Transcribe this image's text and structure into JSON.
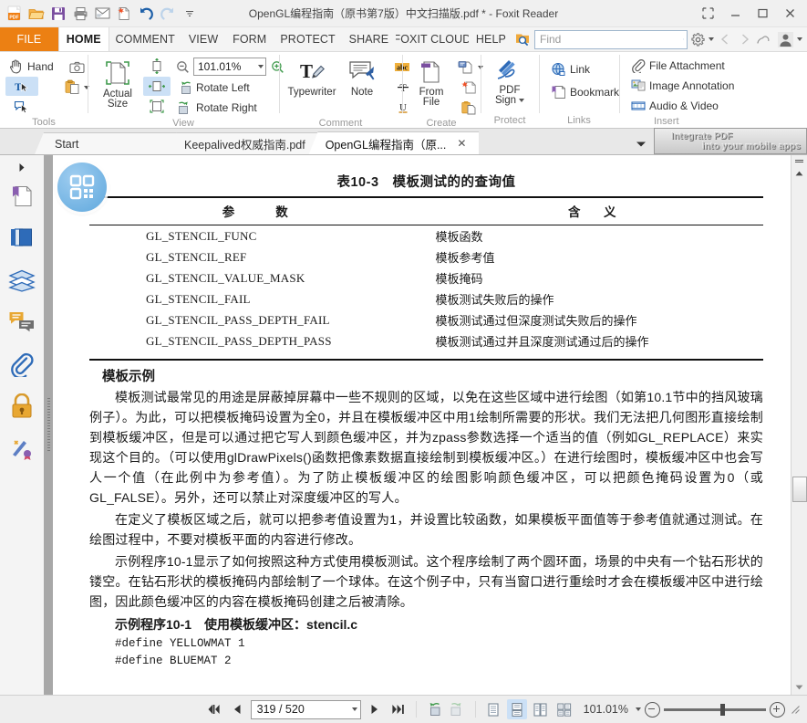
{
  "window": {
    "title": "OpenGL编程指南（原书第7版）中文扫描版.pdf * - Foxit Reader",
    "quick_access": [
      "pdf-logo-icon",
      "open-icon",
      "save-icon",
      "print-icon",
      "email-icon",
      "new-from-file-icon",
      "undo-icon",
      "redo-icon",
      "customize-qat-icon"
    ],
    "controls": [
      "restore-small-icon",
      "minimize-icon",
      "maximize-icon",
      "close-icon"
    ]
  },
  "ribbon": {
    "tabs": [
      {
        "label": "FILE",
        "id": "file"
      },
      {
        "label": "HOME",
        "id": "home"
      },
      {
        "label": "COMMENT",
        "id": "comment"
      },
      {
        "label": "VIEW",
        "id": "view"
      },
      {
        "label": "FORM",
        "id": "form"
      },
      {
        "label": "PROTECT",
        "id": "protect"
      },
      {
        "label": "SHARE",
        "id": "share"
      },
      {
        "label": "FOXIT CLOUD",
        "id": "foxit-cloud"
      },
      {
        "label": "HELP",
        "id": "help"
      }
    ],
    "active_tab": "HOME",
    "search": {
      "placeholder": "Find",
      "value": ""
    },
    "groups": [
      {
        "title": "Tools"
      },
      {
        "title": "View"
      },
      {
        "title": "Comment"
      },
      {
        "title": "Create"
      },
      {
        "title": "Protect"
      },
      {
        "title": "Links"
      },
      {
        "title": "Insert"
      }
    ],
    "tools": {
      "hand": "Hand",
      "snapshot_icon": "camera-icon",
      "select_text_icon": "select-text-icon",
      "select_annotation_icon": "select-annotation-icon",
      "clipboard_icon": "clipboard-paste-icon"
    },
    "view": {
      "actual_size": "Actual\nSize",
      "actual_size_l1": "Actual",
      "actual_size_l2": "Size",
      "fit_page_icon": "fit-page-icon",
      "fit_width_icon": "fit-width-icon",
      "fit_visible_icon": "fit-visible-icon",
      "zoom_out_icon": "zoom-out-icon",
      "zoom_in_icon": "zoom-in-icon",
      "zoom_value": "101.01%",
      "rotate_left": "Rotate Left",
      "rotate_right": "Rotate Right"
    },
    "comment": {
      "typewriter": "Typewriter",
      "note": "Note",
      "highlight_icon": "abc-highlight-icon",
      "strikeout_icon": "strikeout-icon",
      "underline_icon": "underline-icon"
    },
    "create": {
      "from_file_l1": "From",
      "from_file_l2": "File",
      "from_scanner_icon": "from-scanner-icon",
      "from_blank_icon": "blank-page-icon",
      "from_clipboard_icon": "from-clipboard-icon"
    },
    "protect": {
      "pdf_sign_l1": "PDF",
      "pdf_sign_l2": "Sign"
    },
    "links": {
      "link": "Link",
      "bookmark": "Bookmark"
    },
    "insert": {
      "file_attachment": "File Attachment",
      "image_annotation": "Image Annotation",
      "audio_video": "Audio & Video"
    }
  },
  "doc_tabs": {
    "items": [
      {
        "label": "Start",
        "active": false,
        "closable": false
      },
      {
        "label": "Keepalived权威指南.pdf",
        "active": false,
        "closable": false
      },
      {
        "label": "OpenGL编程指南（原...",
        "active": true,
        "closable": true,
        "close_label": "✕"
      }
    ],
    "overflow_icon": "chevron-down-icon",
    "promo_line1": "Integrate PDF",
    "promo_line2": "into your mobile apps"
  },
  "nav_pane": {
    "expander_icon": "expand-pane-icon",
    "items": [
      {
        "icon": "bookmarks-icon",
        "name": "bookmarks"
      },
      {
        "icon": "page-thumbnails-icon",
        "name": "page-thumbnails"
      },
      {
        "icon": "layers-icon",
        "name": "layers"
      },
      {
        "icon": "comments-icon",
        "name": "comments"
      },
      {
        "icon": "attachments-icon",
        "name": "attachments"
      },
      {
        "icon": "security-lock-icon",
        "name": "security"
      },
      {
        "icon": "digital-signature-icon",
        "name": "digital-signatures"
      }
    ]
  },
  "document": {
    "qr_badge_icon": "qr-code-icon",
    "table": {
      "caption": "表10-3　模板测试的的查询值",
      "headers": [
        "参　　数",
        "含　义"
      ],
      "rows": [
        [
          "GL_STENCIL_FUNC",
          "模板函数"
        ],
        [
          "GL_STENCIL_REF",
          "模板参考值"
        ],
        [
          "GL_STENCIL_VALUE_MASK",
          "模板掩码"
        ],
        [
          "GL_STENCIL_FAIL",
          "模板测试失败后的操作"
        ],
        [
          "GL_STENCIL_PASS_DEPTH_FAIL",
          "模板测试通过但深度测试失败后的操作"
        ],
        [
          "GL_STENCIL_PASS_DEPTH_PASS",
          "模板测试通过并且深度测试通过后的操作"
        ]
      ]
    },
    "section_heading": "模板示例",
    "paragraphs": [
      "模板测试最常见的用途是屏蔽掉屏幕中一些不规则的区域，以免在这些区域中进行绘图（如第10.1节中的挡风玻璃例子）。为此，可以把模板掩码设置为全0，并且在模板缓冲区中用1绘制所需要的形状。我们无法把几何图形直接绘制到模板缓冲区，但是可以通过把它写人到颜色缓冲区，并为zpass参数选择一个适当的值（例如GL_REPLACE）来实现这个目的。（可以使用glDrawPixels()函数把像素数据直接绘制到模板缓冲区。）在进行绘图时，模板缓冲区中也会写人一个值（在此例中为参考值）。为了防止模板缓冲区的绘图影响颜色缓冲区，可以把颜色掩码设置为0（或GL_FALSE）。另外，还可以禁止对深度缓冲区的写人。",
      "在定义了模板区域之后，就可以把参考值设置为1，并设置比较函数，如果模板平面值等于参考值就通过测试。在绘图过程中，不要对模板平面的内容进行修改。",
      "示例程序10-1显示了如何按照这种方式使用模板测试。这个程序绘制了两个圆环面，场景的中央有一个钻石形状的镂空。在钻石形状的模板掩码内部绘制了一个球体。在这个例子中，只有当窗口进行重绘时才会在模板缓冲区中进行绘图，因此颜色缓冲区的内容在模板掩码创建之后被清除。"
    ],
    "listing_heading": "示例程序10-1　使用模板缓冲区：stencil.c",
    "code_lines": [
      "#define YELLOWMAT 1",
      "#define BLUEMAT 2"
    ]
  },
  "status_bar": {
    "first_page_icon": "first-page-icon",
    "prev_page_icon": "previous-page-icon",
    "page_value": "319 / 520",
    "next_page_icon": "next-page-icon",
    "last_page_icon": "last-page-icon",
    "rotate_view_left_icon": "rotate-view-left-icon",
    "rotate_view_right_icon": "rotate-view-right-icon",
    "single_page_icon": "single-page-view-icon",
    "continuous_icon": "continuous-view-icon",
    "facing_icon": "facing-view-icon",
    "continuous_facing_icon": "continuous-facing-view-icon",
    "zoom_value": "101.01%",
    "zoom_out_icon": "zoom-out-circle-icon",
    "zoom_in_icon": "zoom-in-circle-icon",
    "resize_grip_icon": "resize-grip-icon"
  },
  "colors": {
    "accent_orange": "#ec8013",
    "ribbon_bg": "#ffffff",
    "selection_blue": "#cbe0f6",
    "splitter_gray": "#a8a8a8"
  }
}
